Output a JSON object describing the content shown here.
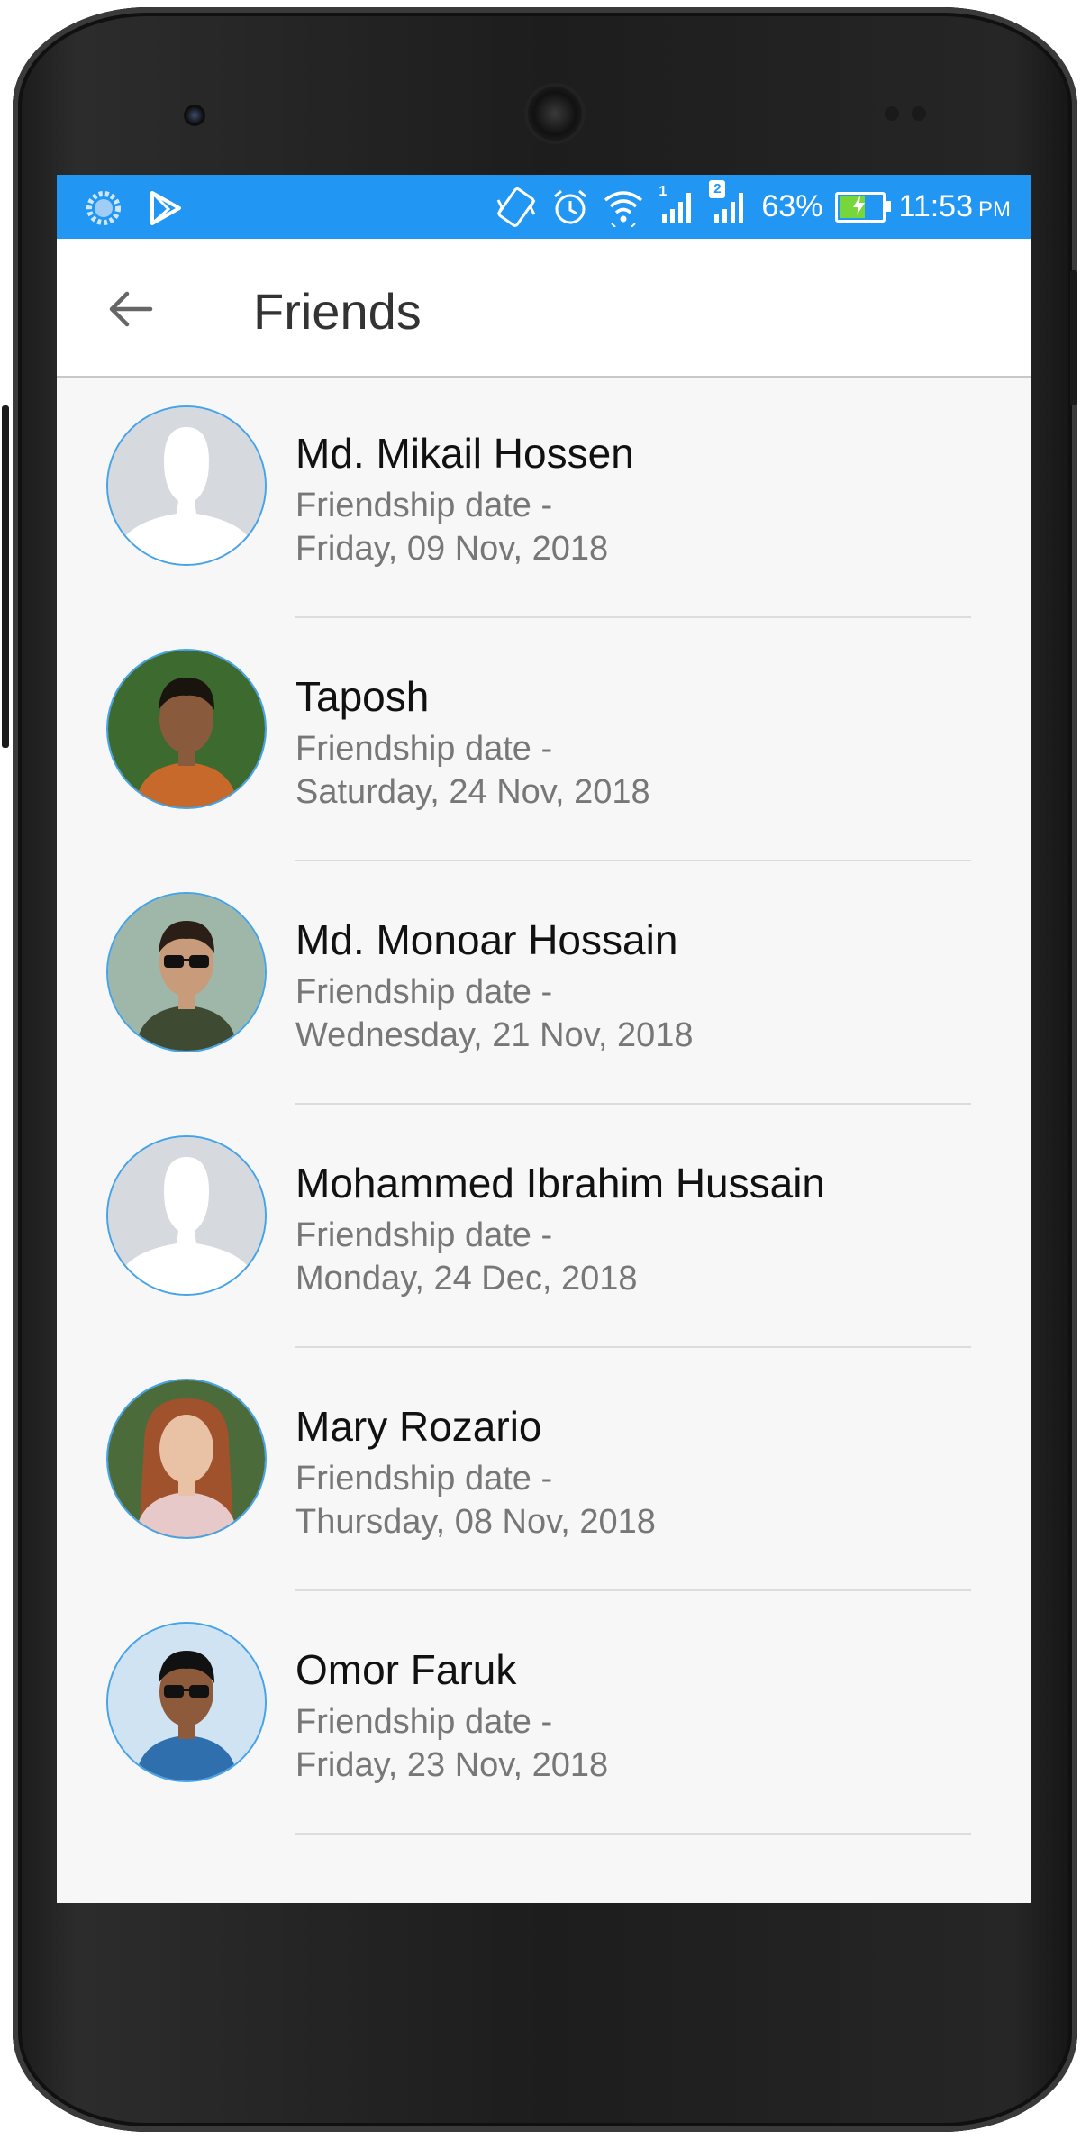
{
  "statusbar": {
    "notification_icons": [
      "loading-icon",
      "play-store-icon"
    ],
    "system_icons": [
      "vibrate-icon",
      "alarm-icon",
      "wifi-icon",
      "signal-sim1-icon",
      "signal-sim2-icon"
    ],
    "sim1_label": "1",
    "sim2_label": "2",
    "battery_text": "63%",
    "battery_level": 0.63,
    "time": "11:53",
    "ampm": "PM",
    "color": "#2196f3"
  },
  "appbar": {
    "back_icon": "arrow-back-icon",
    "title": "Friends"
  },
  "friends": [
    {
      "name": "Md. Mikail Hossen",
      "label": "Friendship date -",
      "date": "Friday, 09 Nov, 2018",
      "avatar": "placeholder"
    },
    {
      "name": "Taposh",
      "label": "Friendship date -",
      "date": "Saturday, 24 Nov, 2018",
      "avatar": "photo"
    },
    {
      "name": "Md. Monoar Hossain",
      "label": "Friendship date -",
      "date": "Wednesday, 21 Nov, 2018",
      "avatar": "photo"
    },
    {
      "name": "Mohammed Ibrahim Hussain",
      "label": "Friendship date -",
      "date": "Monday, 24 Dec, 2018",
      "avatar": "placeholder"
    },
    {
      "name": "Mary Rozario",
      "label": "Friendship date -",
      "date": "Thursday, 08 Nov, 2018",
      "avatar": "photo"
    },
    {
      "name": "Omor Faruk",
      "label": "Friendship date -",
      "date": "Friday, 23 Nov, 2018",
      "avatar": "photo"
    }
  ]
}
